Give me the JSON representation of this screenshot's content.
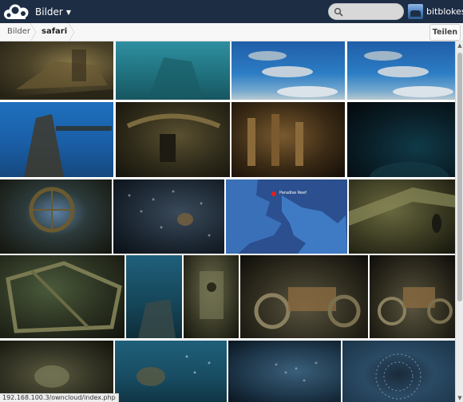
{
  "header": {
    "app_menu_label": "Bilder",
    "search_placeholder": "",
    "user_name": "bitblokes"
  },
  "controls": {
    "breadcrumb_home": "Bilder",
    "breadcrumb_current": "safari",
    "share_label": "Teilen"
  },
  "status_url": "192.168.100.3/owncloud/index.php",
  "map_thumbnail": {
    "place_label": "Paradise Reef"
  },
  "colors": {
    "header_bg": "#1d2d44",
    "controls_bg": "#f7f7f7"
  },
  "thumbnails": [
    {
      "id": "wreck-deck",
      "palette": "wreck"
    },
    {
      "id": "teal-water",
      "palette": "teal"
    },
    {
      "id": "dolphins-1",
      "palette": "dolphins"
    },
    {
      "id": "dolphins-2",
      "palette": "dolphins"
    },
    {
      "id": "wreck-blue",
      "palette": "wreckblue"
    },
    {
      "id": "wreck-cabin",
      "palette": "cabin"
    },
    {
      "id": "wreck-engine",
      "palette": "engine"
    },
    {
      "id": "dark-diver",
      "palette": "dark"
    },
    {
      "id": "wreck-window",
      "palette": "window"
    },
    {
      "id": "fish-school",
      "palette": "fish"
    },
    {
      "id": "map",
      "palette": "map"
    },
    {
      "id": "wreck-interior",
      "palette": "interior"
    },
    {
      "id": "wreck-hull",
      "palette": "hull"
    },
    {
      "id": "diver-deep",
      "palette": "deep"
    },
    {
      "id": "wreck-stern",
      "palette": "stern"
    },
    {
      "id": "motorbike-1",
      "palette": "bike"
    },
    {
      "id": "motorbike-2",
      "palette": "bike"
    },
    {
      "id": "wreck-bottom",
      "palette": "bottom"
    },
    {
      "id": "diver-fish",
      "palette": "divefish"
    },
    {
      "id": "fish-cloud",
      "palette": "cloud"
    },
    {
      "id": "fish-swirl",
      "palette": "swirl"
    }
  ]
}
